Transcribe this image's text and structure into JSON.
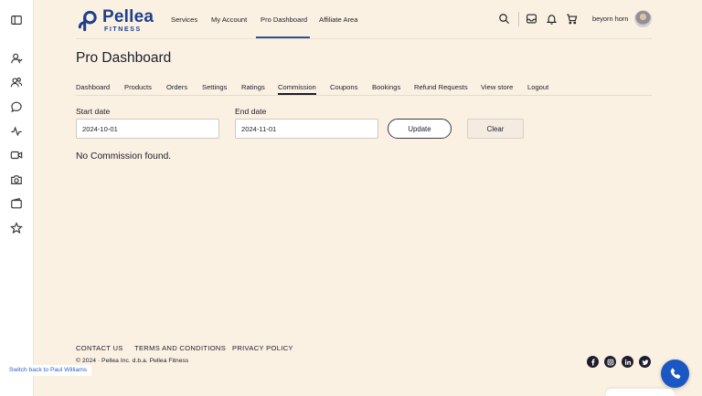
{
  "brand": {
    "name": "Pellea",
    "sub": "FITNESS",
    "color": "#1d3f8f"
  },
  "topnav": {
    "services": "Services",
    "my_account": "My Account",
    "pro_dashboard": "Pro Dashboard",
    "affiliate_area": "Affiliate Area"
  },
  "header": {
    "user_name": "beyorn horn"
  },
  "sidebar": {
    "icons": [
      "sidebar-toggle-icon",
      "user-icon",
      "users-icon",
      "chat-icon",
      "activity-icon",
      "video-icon",
      "camera-icon",
      "wallet-icon",
      "star-icon"
    ]
  },
  "page": {
    "title": "Pro Dashboard"
  },
  "tabs": [
    "Dashboard",
    "Products",
    "Orders",
    "Settings",
    "Ratings",
    "Commission",
    "Coupons",
    "Bookings",
    "Refund Requests",
    "View store",
    "Logout"
  ],
  "active_tab": "Commission",
  "filters": {
    "start_label": "Start date",
    "start_value": "2024-10-01",
    "end_label": "End date",
    "end_value": "2024-11-01",
    "update_label": "Update",
    "clear_label": "Clear"
  },
  "results": {
    "empty_message": "No Commission found."
  },
  "footer": {
    "contact": "CONTACT US",
    "terms": "TERMS AND CONDITIONS",
    "privacy": "PRIVACY POLICY",
    "copyright": "© 2024 · Pellea Inc. d.b.a. Pellea Fitness",
    "social": [
      "facebook-icon",
      "instagram-icon",
      "linkedin-icon",
      "twitter-icon"
    ]
  },
  "switch_back": "Switch back to Paul Williams",
  "colors": {
    "background": "#fbf1e3",
    "accent": "#2e4f9e",
    "phone_button": "#1a56c4"
  }
}
